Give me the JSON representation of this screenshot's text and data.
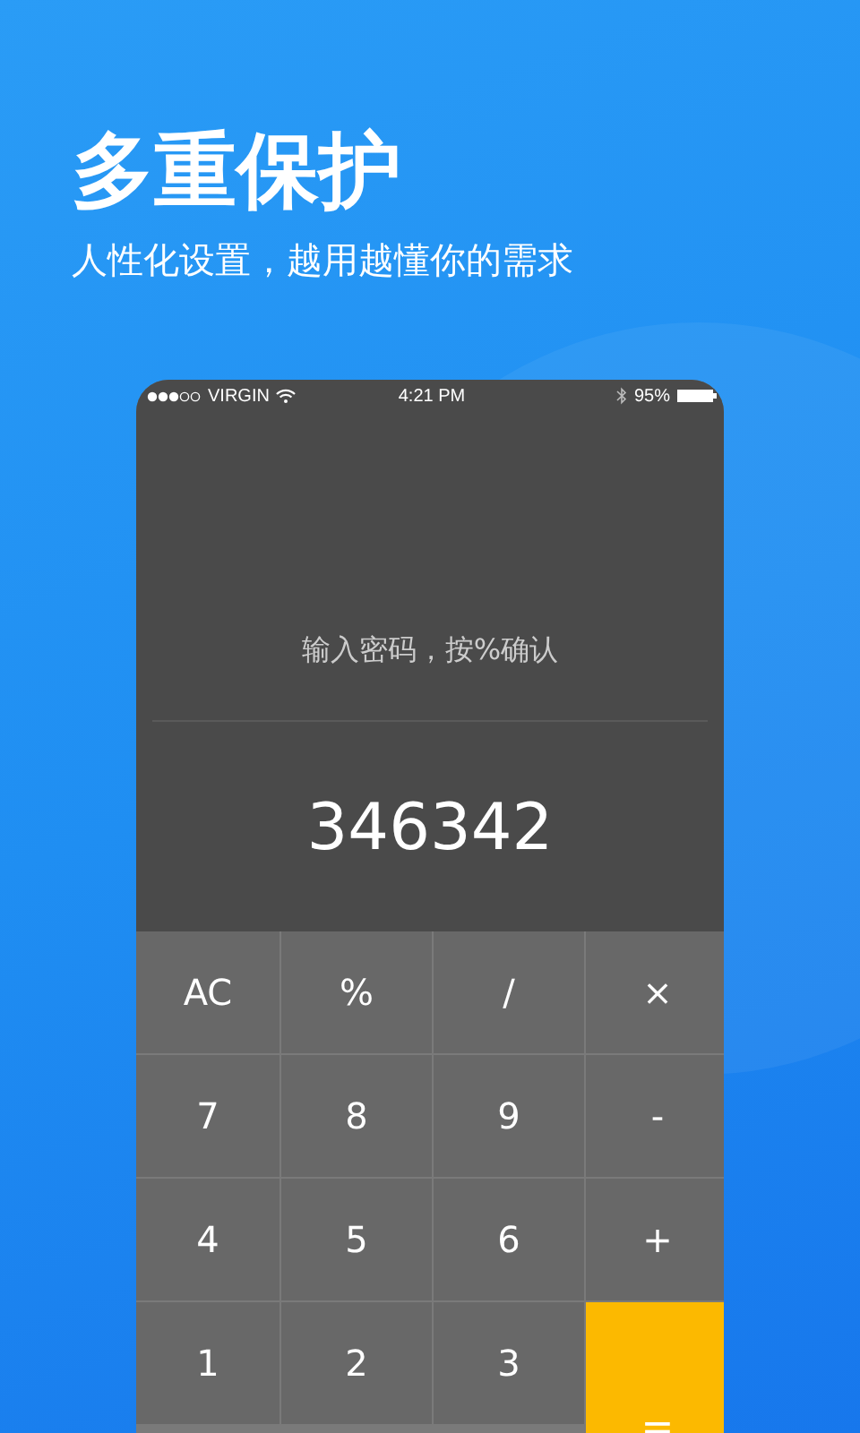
{
  "headline": "多重保护",
  "subtitle": "人性化设置，越用越懂你的需求",
  "status_bar": {
    "carrier": "VIRGIN",
    "time": "4:21 PM",
    "battery": "95%"
  },
  "display": {
    "prompt": "输入密码，按%确认",
    "value": "346342"
  },
  "keys": [
    {
      "label": "AC",
      "kind": "op"
    },
    {
      "label": "%",
      "kind": "op"
    },
    {
      "label": "/",
      "kind": "op"
    },
    {
      "label": "×",
      "kind": "op"
    },
    {
      "label": "7",
      "kind": "digit"
    },
    {
      "label": "8",
      "kind": "digit"
    },
    {
      "label": "9",
      "kind": "digit"
    },
    {
      "label": "-",
      "kind": "op"
    },
    {
      "label": "4",
      "kind": "digit"
    },
    {
      "label": "5",
      "kind": "digit"
    },
    {
      "label": "6",
      "kind": "digit"
    },
    {
      "label": "+",
      "kind": "op"
    },
    {
      "label": "1",
      "kind": "digit"
    },
    {
      "label": "2",
      "kind": "digit"
    },
    {
      "label": "3",
      "kind": "digit"
    },
    {
      "label": "=",
      "kind": "equals"
    }
  ]
}
